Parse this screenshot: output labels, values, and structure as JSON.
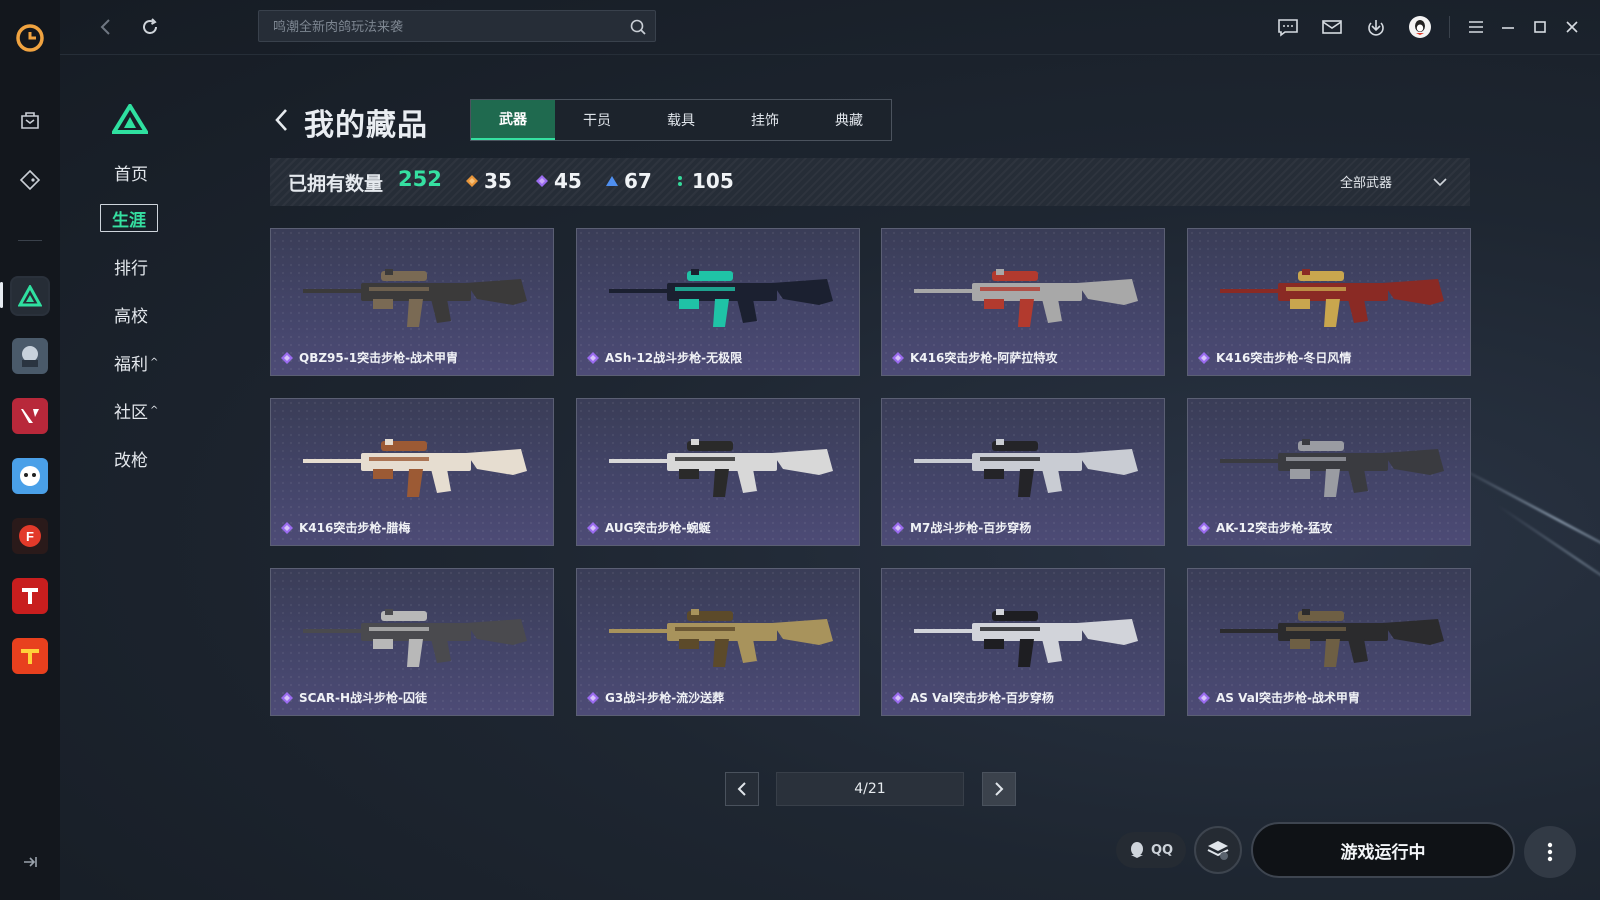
{
  "search": {
    "placeholder": "鸣潮全新肉鸽玩法来袭"
  },
  "sidenav": {
    "items": [
      {
        "label": "首页",
        "caret": ""
      },
      {
        "label": "生涯",
        "caret": ""
      },
      {
        "label": "排行",
        "caret": ""
      },
      {
        "label": "高校",
        "caret": ""
      },
      {
        "label": "福利",
        "caret": "^"
      },
      {
        "label": "社区",
        "caret": "^"
      },
      {
        "label": "改枪",
        "caret": ""
      }
    ]
  },
  "page": {
    "title": "我的藏品"
  },
  "tabs": [
    "武器",
    "干员",
    "载具",
    "挂饰",
    "典藏"
  ],
  "stats": {
    "owned_label": "已拥有数量",
    "owned_count": "252",
    "counts": [
      {
        "value": "35",
        "color": "#e8953a"
      },
      {
        "value": "45",
        "color": "#9b6cf0"
      },
      {
        "value": "67",
        "color": "#4f8ff0"
      },
      {
        "value": "105",
        "color": "#35d89a"
      }
    ],
    "filter": "全部武器"
  },
  "cards": [
    {
      "name": "QBZ95-1突击步枪-战术甲胄",
      "rarity_color": "#9b6cf0",
      "body": "#3b3a3a",
      "accent": "#7a6a54"
    },
    {
      "name": "ASh-12战斗步枪-无极限",
      "rarity_color": "#9b6cf0",
      "body": "#1b2030",
      "accent": "#1fc3a6"
    },
    {
      "name": "K416突击步枪-阿萨拉特攻",
      "rarity_color": "#9b6cf0",
      "body": "#a8a8a8",
      "accent": "#b23a2e"
    },
    {
      "name": "K416突击步枪-冬日风情",
      "rarity_color": "#9b6cf0",
      "body": "#8a2a24",
      "accent": "#c9a64e"
    },
    {
      "name": "K416突击步枪-腊梅",
      "rarity_color": "#9b6cf0",
      "body": "#e6ddd0",
      "accent": "#9c5a34"
    },
    {
      "name": "AUG突击步枪-蜿蜒",
      "rarity_color": "#9b6cf0",
      "body": "#d8d8d8",
      "accent": "#2a2a2a"
    },
    {
      "name": "M7战斗步枪-百步穿杨",
      "rarity_color": "#9b6cf0",
      "body": "#c9ccd3",
      "accent": "#242428"
    },
    {
      "name": "AK-12突击步枪-猛攻",
      "rarity_color": "#9b6cf0",
      "body": "#3a3b40",
      "accent": "#9a9ca2"
    },
    {
      "name": "SCAR-H战斗步枪-囚徒",
      "rarity_color": "#9b6cf0",
      "body": "#4a4a4e",
      "accent": "#b8b8b8"
    },
    {
      "name": "G3战斗步枪-流沙送葬",
      "rarity_color": "#9b6cf0",
      "body": "#a8935c",
      "accent": "#5c4a2a"
    },
    {
      "name": "AS Val突击步枪-百步穿杨",
      "rarity_color": "#9b6cf0",
      "body": "#d2d4da",
      "accent": "#1e1e22"
    },
    {
      "name": "AS Val突击步枪-战术甲胄",
      "rarity_color": "#9b6cf0",
      "body": "#2b2b2d",
      "accent": "#6e5f44"
    }
  ],
  "pagination": {
    "indicator": "4/21"
  },
  "bottom": {
    "qq_label": "QQ",
    "launch_label": "游戏运行中"
  },
  "colors": {
    "accent": "#35e0a1",
    "rarity_purple": "#9b6cf0"
  }
}
